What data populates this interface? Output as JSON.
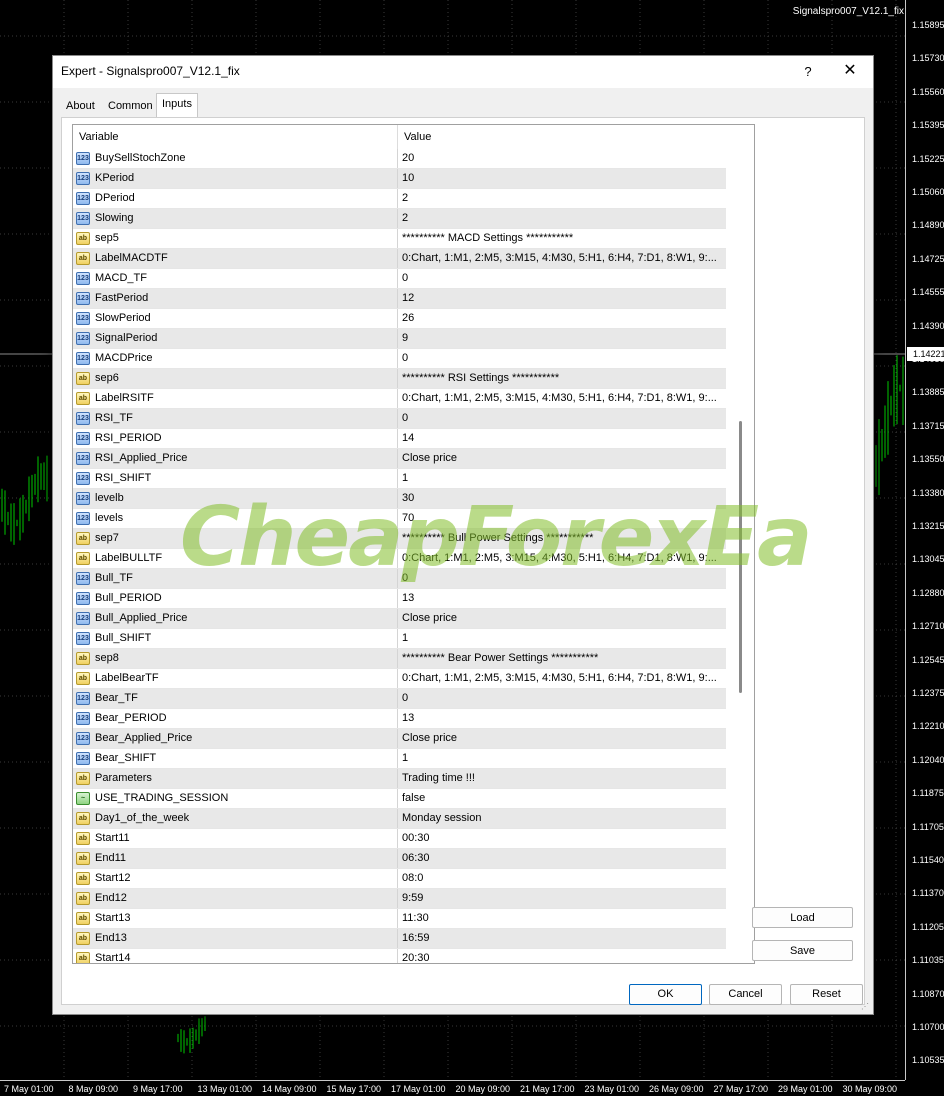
{
  "chart": {
    "title": "Signalspro007_V12.1_fix",
    "price_labels": [
      "1.15895",
      "1.15730",
      "1.15560",
      "1.15395",
      "1.15225",
      "1.15060",
      "1.14890",
      "1.14725",
      "1.14555",
      "1.14390",
      "1.14050",
      "1.13885",
      "1.13715",
      "1.13550",
      "1.13380",
      "1.13215",
      "1.13045",
      "1.12880",
      "1.12710",
      "1.12545",
      "1.12375",
      "1.12210",
      "1.12040",
      "1.11875",
      "1.11705",
      "1.11540",
      "1.11370",
      "1.11205",
      "1.11035",
      "1.10870",
      "1.10700",
      "1.10535"
    ],
    "current_price": "1.14221",
    "time_labels": [
      "7 May 01:00",
      "8 May 09:00",
      "9 May 17:00",
      "13 May 01:00",
      "14 May 09:00",
      "15 May 17:00",
      "17 May 01:00",
      "20 May 09:00",
      "21 May 17:00",
      "23 May 01:00",
      "26 May 09:00",
      "27 May 17:00",
      "29 May 01:00",
      "30 May 09:00"
    ]
  },
  "dialog": {
    "title": "Expert - Signalspro007_V12.1_fix",
    "help": "?",
    "close": "✕",
    "tabs": [
      "About",
      "Common",
      "Inputs"
    ],
    "active_tab": "Inputs",
    "grid": {
      "col_variable": "Variable",
      "col_value": "Value",
      "rows": [
        {
          "type": "int",
          "name": "BuySellStochZone",
          "value": "20"
        },
        {
          "type": "int",
          "name": "KPeriod",
          "value": "10"
        },
        {
          "type": "int",
          "name": "DPeriod",
          "value": "2"
        },
        {
          "type": "int",
          "name": "Slowing",
          "value": "2"
        },
        {
          "type": "str",
          "name": "sep5",
          "value": "********** MACD Settings ***********"
        },
        {
          "type": "str",
          "name": "LabelMACDTF",
          "value": "0:Chart, 1:M1, 2:M5, 3:M15, 4:M30, 5:H1, 6:H4, 7:D1, 8:W1, 9:..."
        },
        {
          "type": "int",
          "name": "MACD_TF",
          "value": "0"
        },
        {
          "type": "int",
          "name": "FastPeriod",
          "value": "12"
        },
        {
          "type": "int",
          "name": "SlowPeriod",
          "value": "26"
        },
        {
          "type": "int",
          "name": "SignalPeriod",
          "value": "9"
        },
        {
          "type": "int",
          "name": "MACDPrice",
          "value": "0"
        },
        {
          "type": "str",
          "name": "sep6",
          "value": "********** RSI Settings ***********"
        },
        {
          "type": "str",
          "name": "LabelRSITF",
          "value": "0:Chart, 1:M1, 2:M5, 3:M15, 4:M30, 5:H1, 6:H4, 7:D1, 8:W1, 9:..."
        },
        {
          "type": "int",
          "name": "RSI_TF",
          "value": "0"
        },
        {
          "type": "int",
          "name": "RSI_PERIOD",
          "value": "14"
        },
        {
          "type": "int",
          "name": "RSI_Applied_Price",
          "value": "Close price"
        },
        {
          "type": "int",
          "name": "RSI_SHIFT",
          "value": "1"
        },
        {
          "type": "int",
          "name": "levelb",
          "value": "30"
        },
        {
          "type": "int",
          "name": "levels",
          "value": "70"
        },
        {
          "type": "str",
          "name": "sep7",
          "value": "********** Bull Power Settings ***********"
        },
        {
          "type": "str",
          "name": "LabelBULLTF",
          "value": "0:Chart, 1:M1, 2:M5, 3:M15, 4:M30, 5:H1, 6:H4, 7:D1, 8:W1, 9:..."
        },
        {
          "type": "int",
          "name": "Bull_TF",
          "value": "0"
        },
        {
          "type": "int",
          "name": "Bull_PERIOD",
          "value": "13"
        },
        {
          "type": "int",
          "name": "Bull_Applied_Price",
          "value": "Close price"
        },
        {
          "type": "int",
          "name": "Bull_SHIFT",
          "value": "1"
        },
        {
          "type": "str",
          "name": "sep8",
          "value": "********** Bear Power Settings ***********"
        },
        {
          "type": "str",
          "name": "LabelBearTF",
          "value": "0:Chart, 1:M1, 2:M5, 3:M15, 4:M30, 5:H1, 6:H4, 7:D1, 8:W1, 9:..."
        },
        {
          "type": "int",
          "name": "Bear_TF",
          "value": "0"
        },
        {
          "type": "int",
          "name": "Bear_PERIOD",
          "value": "13"
        },
        {
          "type": "int",
          "name": "Bear_Applied_Price",
          "value": "Close price"
        },
        {
          "type": "int",
          "name": "Bear_SHIFT",
          "value": "1"
        },
        {
          "type": "str",
          "name": "Parameters",
          "value": "Trading time !!!"
        },
        {
          "type": "bool",
          "name": "USE_TRADING_SESSION",
          "value": "false"
        },
        {
          "type": "str",
          "name": "Day1_of_the_week",
          "value": "Monday session"
        },
        {
          "type": "str",
          "name": "Start11",
          "value": "00:30"
        },
        {
          "type": "str",
          "name": "End11",
          "value": "06:30"
        },
        {
          "type": "str",
          "name": "Start12",
          "value": "08:0"
        },
        {
          "type": "str",
          "name": "End12",
          "value": "9:59"
        },
        {
          "type": "str",
          "name": "Start13",
          "value": "11:30"
        },
        {
          "type": "str",
          "name": "End13",
          "value": "16:59"
        },
        {
          "type": "str",
          "name": "Start14",
          "value": "20:30"
        }
      ]
    },
    "buttons": {
      "load": "Load",
      "save": "Save",
      "ok": "OK",
      "cancel": "Cancel",
      "reset": "Reset"
    },
    "icon_text": {
      "int": "123",
      "str": "ab",
      "bool": "~"
    }
  },
  "watermark": "CheapForexEa",
  "colors": {
    "chart_bg": "#000000",
    "candle": "#00c800",
    "grid_dots": "#3a3a3a",
    "watermark": "#82be28",
    "accent_button": "#0067c0"
  }
}
